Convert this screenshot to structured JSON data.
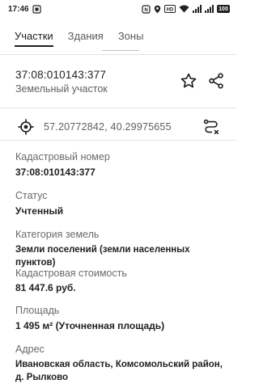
{
  "status_bar": {
    "time": "17:46",
    "battery_level": "100",
    "icons": [
      "screen-record-icon",
      "nfc-icon",
      "location-icon",
      "hd-icon",
      "wifi-icon",
      "signal-icon",
      "signal-icon",
      "battery-icon"
    ]
  },
  "tabs": [
    {
      "label": "Участки",
      "active": true
    },
    {
      "label": "Здания",
      "active": false
    },
    {
      "label": "Зоны",
      "active": false
    }
  ],
  "header": {
    "cadastral_id": "37:08:010143:377",
    "type": "Земельный участок"
  },
  "coordinates": {
    "text": "57.20772842, 40.29975655"
  },
  "fields": [
    {
      "label": "Кадастровый номер",
      "value": "37:08:010143:377"
    },
    {
      "label": "Статус",
      "value": "Учтенный"
    },
    {
      "label": "Категория земель",
      "value": "Земли поселений (земли населенных пунктов)"
    },
    {
      "label": "Кадастровая стоимость",
      "value": "81 447.6 руб."
    },
    {
      "label": "Площадь",
      "value": "1 495 м² (Уточненная площадь)"
    },
    {
      "label": "Адрес",
      "value": "Ивановская область, Комсомольский район, д. Рылково"
    }
  ],
  "colors": {
    "text": "#1f1f1f",
    "secondary": "#5f5f5f",
    "divider": "#e3e3e3"
  }
}
